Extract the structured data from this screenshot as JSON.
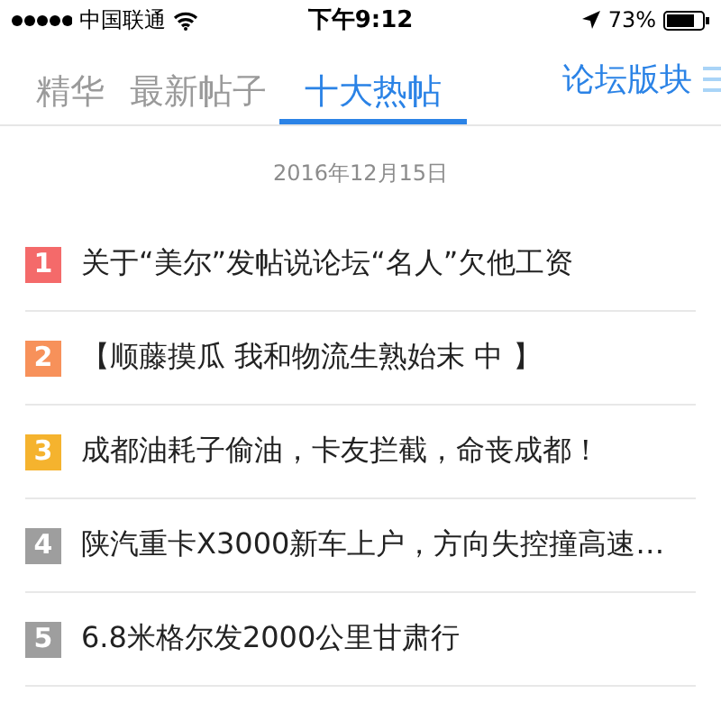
{
  "status_bar": {
    "carrier": "中国联通",
    "time": "下午9:12",
    "battery": "73%"
  },
  "tabs": [
    {
      "label": "精华",
      "selected": false
    },
    {
      "label": "最新帖子",
      "selected": false
    },
    {
      "label": "十大热帖",
      "selected": true
    }
  ],
  "forum_link": "论坛版块",
  "date": "2016年12月15日",
  "posts": [
    {
      "rank": "1",
      "color": "#f46a6a",
      "title": "关于“美尔”发帖说论坛“名人”欠他工资"
    },
    {
      "rank": "2",
      "color": "#f7915a",
      "title": "【顺藤摸瓜 我和物流生熟始末 中 】"
    },
    {
      "rank": "3",
      "color": "#f5b32e",
      "title": "成都油耗子偷油，卡友拦截，命丧成都！"
    },
    {
      "rank": "4",
      "color": "#9e9e9e",
      "title": "陕汽重卡X3000新车上户，方向失控撞高速…"
    },
    {
      "rank": "5",
      "color": "#9e9e9e",
      "title": "6.8米格尔发2000公里甘肃行"
    }
  ]
}
